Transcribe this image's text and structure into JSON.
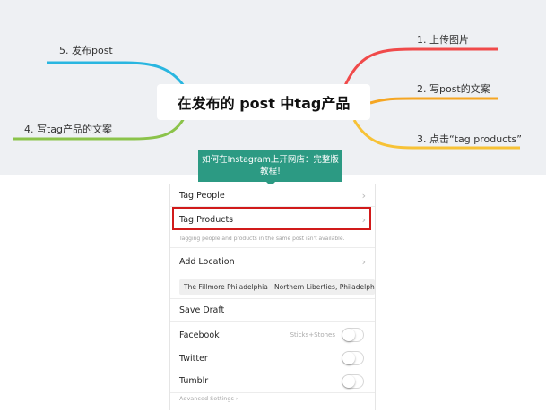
{
  "mindmap": {
    "center": "在发布的 post 中tag产品",
    "branches": {
      "b1": "1. 上传图片",
      "b2": "2. 写post的文案",
      "b3": "3. 点击“tag products”",
      "b4": "4. 写tag产品的文案",
      "b5": "5. 发布post"
    },
    "colors": {
      "b1": "#f04a4a",
      "b2": "#f5a623",
      "b3": "#f7c236",
      "b4": "#8bc34a",
      "b5": "#29b6e0"
    }
  },
  "tooltip": {
    "text": "如何在Instagram上开网店：完整版教程!"
  },
  "settings": {
    "tag_people": "Tag People",
    "tag_products": "Tag Products",
    "note": "Tagging people and products in the same post isn't available.",
    "add_location": "Add Location",
    "location_chips": [
      "The Fillmore Philadelphia",
      "Northern Liberties, Philadelphia"
    ],
    "save_draft": "Save Draft",
    "facebook": "Facebook",
    "facebook_sub": "Sticks+Stones",
    "twitter": "Twitter",
    "tumblr": "Tumblr",
    "advanced": "Advanced Settings ›",
    "chevron": "›"
  }
}
